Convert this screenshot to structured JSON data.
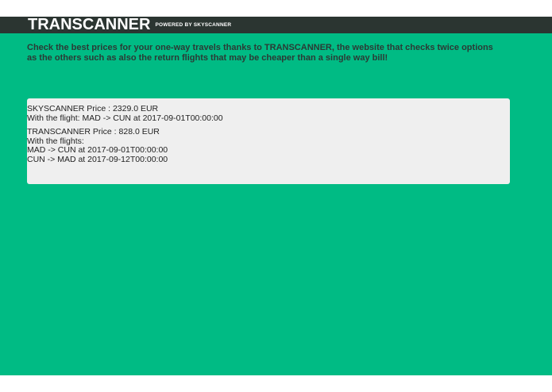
{
  "header": {
    "logo": "TRANSCANNER",
    "powered_by": "POWERED BY SKYSCANNER"
  },
  "intro": {
    "text": "Check the best prices for your one-way travels thanks to TRANSCANNER, the website that checks twice options as the others such as also the return flights that may be cheaper than a single way bill!"
  },
  "results": {
    "skyscanner_price": "SKYSCANNER Price : 2329.0 EUR",
    "skyscanner_flight": "With the flight: MAD -> CUN at 2017-09-01T00:00:00",
    "transcanner_price": "TRANSCANNER Price : 828.0 EUR",
    "transcanner_flights_label": "With the flights:",
    "flights": [
      "MAD -> CUN at 2017-09-01T00:00:00",
      "CUN -> MAD at 2017-09-12T00:00:00"
    ]
  },
  "colors": {
    "header_bg": "#2b3531",
    "main_bg": "#00bb84",
    "box_bg": "#efefef",
    "intro_text": "#2b3a35"
  }
}
